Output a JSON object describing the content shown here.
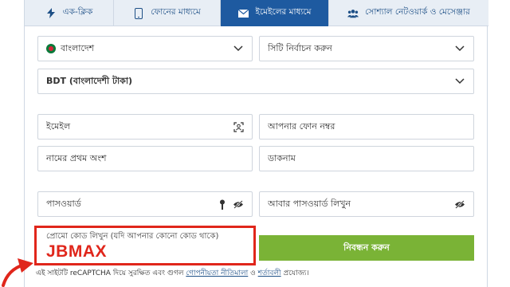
{
  "tabs": [
    {
      "label": "এক-ক্লিক",
      "icon": "lightning-icon",
      "active": false
    },
    {
      "label": "ফোনের মাধ্যমে",
      "icon": "phone-icon",
      "active": false
    },
    {
      "label": "ইমেইলের মাধ্যমে",
      "icon": "envelope-icon",
      "active": true
    },
    {
      "label": "সোশ্যাল নেটওয়ার্ক ও মেসেঞ্জার",
      "icon": "users-icon",
      "active": false
    }
  ],
  "form": {
    "country": "বাংলাদেশ",
    "city_placeholder": "সিটি নির্বাচন করুন",
    "currency": "BDT (বাংলাদেশী টাকা)",
    "email_placeholder": "ইমেইল",
    "phone_placeholder": "আপনার ফোন নম্বর",
    "first_name_placeholder": "নামের প্রথম অংশ",
    "nickname_placeholder": "ডাকনাম",
    "password_placeholder": "পাসওয়ার্ড",
    "repeat_password_placeholder": "আবার পাসওয়ার্ড লিখুন",
    "promo_label": "প্রোমো কোড লিখুন (যদি আপনার কোনো কোড থাকে)",
    "promo_value": "JBMAX",
    "submit_label": "নিবন্ধন করুন"
  },
  "footer": {
    "prefix": "এই সাইটটি reCAPTCHA দিয়ে সুরক্ষিত এবং গুগল",
    "privacy_link": "গোপনীয়তা নীতিমালা",
    "and": "ও",
    "terms_link": "শর্তাবলী",
    "suffix": "প্রযোজ্য।"
  },
  "colors": {
    "active_tab": "#1e5aa0",
    "submit": "#7ab336",
    "highlight": "#e0261b"
  }
}
